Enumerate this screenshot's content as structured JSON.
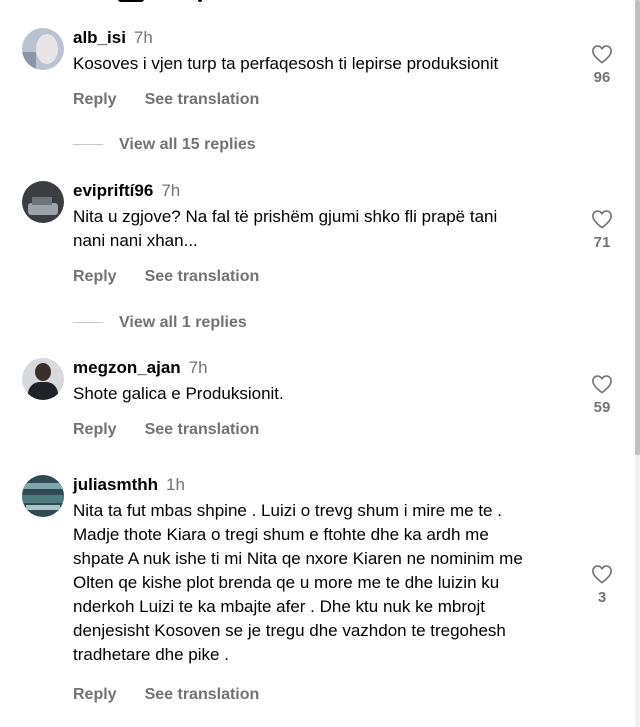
{
  "comments": [
    {
      "username": "alb_isi",
      "time": "7h",
      "text": "Kosoves i vjen turp ta perfaqesosh ti lepirse produksionit",
      "likes": "96",
      "reply": "Reply",
      "see_translation": "See translation",
      "view_replies": "View all 15 replies"
    },
    {
      "username": "evipriftí96",
      "time": "7h",
      "text": "Nita u zgjove? Na fal të prishëm gjumi shko fli prapë tani\nnani nani xhan...",
      "likes": "71",
      "reply": "Reply",
      "see_translation": "See translation",
      "view_replies": "View all 1 replies"
    },
    {
      "username": "megzon_ajan",
      "time": "7h",
      "text": "Shote galica e Produksionit.",
      "likes": "59",
      "reply": "Reply",
      "see_translation": "See translation"
    },
    {
      "username": "juliasmthh",
      "time": "1h",
      "text": "Nita ta fut mbas shpine . Luizi o trevg shum i mire me te .\nMadje thote Kiara o tregi shum e ftohte dhe ka ardh me\nshpate A nuk ishe ti mi Nita qe nxore Kiaren ne nominim me\nOlten qe kishe plot brenda qe u more me te dhe luizin ku\nnderkoh Luizi te ka mbajte afer . Dhe ktu nuk ke mbrojt\ndenjesisht Kosoven se je tregu dhe vazhdon te tregohesh\ntradhetare dhe pike .",
      "likes": "3",
      "reply": "Reply",
      "see_translation": "See translation"
    }
  ]
}
